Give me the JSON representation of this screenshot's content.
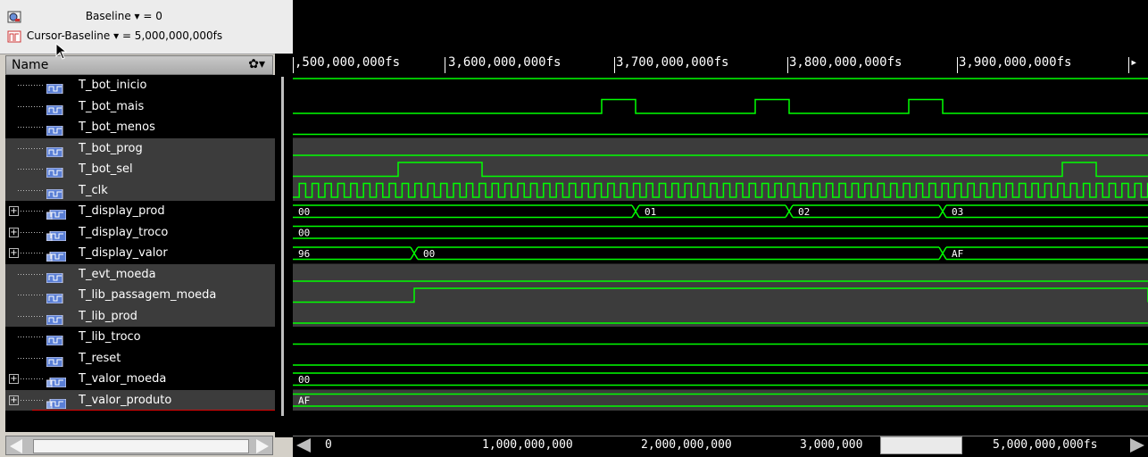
{
  "toolbar": {
    "baseline_label": "Baseline ▾ = 0",
    "cursor_baseline_label": "Cursor-Baseline ▾ = 5,000,000,000fs"
  },
  "names_panel": {
    "header": "Name",
    "signals": [
      {
        "name": "T_bot_inicio",
        "bus": false,
        "grey": false
      },
      {
        "name": "T_bot_mais",
        "bus": false,
        "grey": false
      },
      {
        "name": "T_bot_menos",
        "bus": false,
        "grey": false
      },
      {
        "name": "T_bot_prog",
        "bus": false,
        "grey": true
      },
      {
        "name": "T_bot_sel",
        "bus": false,
        "grey": true
      },
      {
        "name": "T_clk",
        "bus": false,
        "grey": true
      },
      {
        "name": "T_display_prod",
        "bus": true,
        "grey": false
      },
      {
        "name": "T_display_troco",
        "bus": true,
        "grey": false
      },
      {
        "name": "T_display_valor",
        "bus": true,
        "grey": false
      },
      {
        "name": "T_evt_moeda",
        "bus": false,
        "grey": true
      },
      {
        "name": "T_lib_passagem_moeda",
        "bus": false,
        "grey": true
      },
      {
        "name": "T_lib_prod",
        "bus": false,
        "grey": true
      },
      {
        "name": "T_lib_troco",
        "bus": false,
        "grey": false
      },
      {
        "name": "T_reset",
        "bus": false,
        "grey": false
      },
      {
        "name": "T_valor_moeda",
        "bus": true,
        "grey": false
      },
      {
        "name": "T_valor_produto",
        "bus": true,
        "grey": true
      }
    ]
  },
  "timeline": {
    "labels": [
      ",500,000,000fs",
      "3,600,000,000fs",
      "3,700,000,000fs",
      "3,800,000,000fs",
      "3,900,000,000fs"
    ]
  },
  "bus_values": {
    "T_display_prod": [
      "00",
      "01",
      "02",
      "03"
    ],
    "T_display_troco": [
      "00"
    ],
    "T_display_valor": [
      "96",
      "00",
      "AF"
    ],
    "T_valor_moeda": [
      "00"
    ],
    "T_valor_produto": [
      "AF"
    ]
  },
  "overview_scroll": {
    "labels": [
      "0",
      "1,000,000,000",
      "2,000,000,000",
      "3,000,000",
      "5,000,000,000fs"
    ]
  },
  "colors": {
    "waveform": "#00ff00",
    "background": "#000000",
    "panel": "#d4d0c8"
  },
  "icons": [
    "zoom-baseline-icon",
    "cursor-baseline-icon",
    "gear-icon",
    "signal-icon",
    "bus-icon"
  ]
}
